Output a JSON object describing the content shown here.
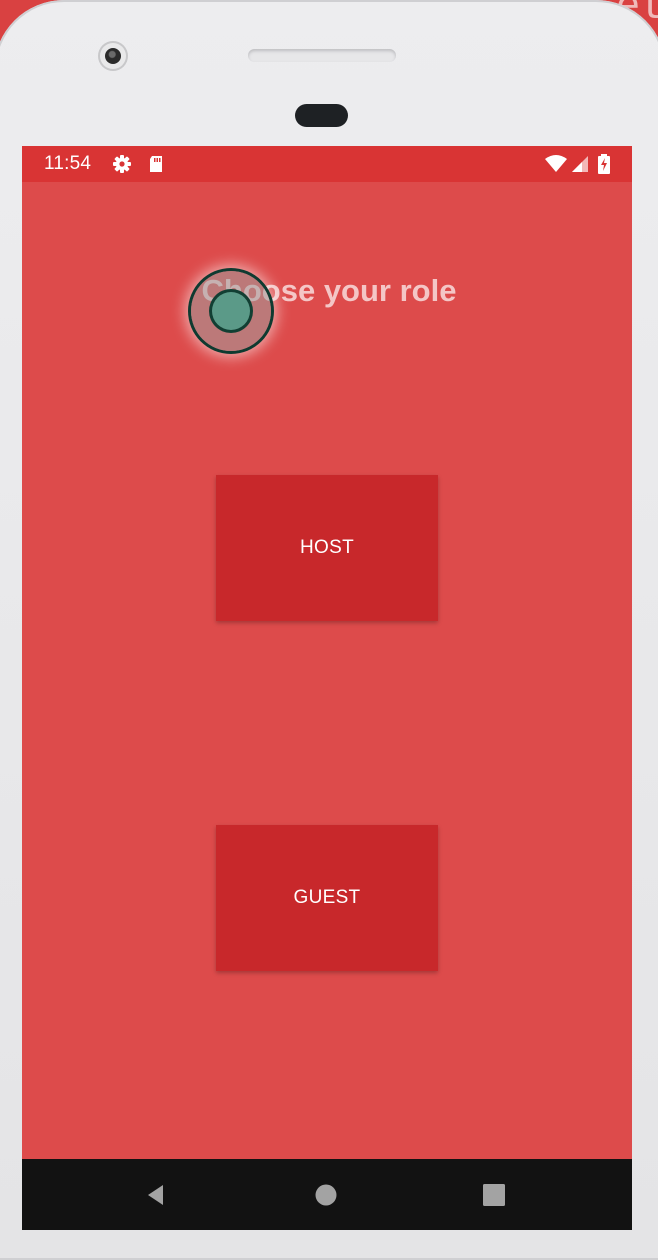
{
  "status_bar": {
    "time": "11:54",
    "icons": [
      "gear-icon",
      "sd-card-icon",
      "wifi-icon",
      "cell-signal-icon",
      "battery-charging-icon"
    ]
  },
  "main": {
    "title": "Choose your role",
    "host_label": "HOST",
    "guest_label": "GUEST"
  },
  "backdrop": {
    "partial_text": "et"
  },
  "nav_bar": {
    "icons": [
      "back-icon",
      "home-icon",
      "recents-icon"
    ]
  },
  "colors": {
    "status_bar": "#d93434",
    "screen_background": "#dd4b4b",
    "button_background": "#c8282b",
    "title_text": "#f4c6c6",
    "nav_bar": "#121212"
  }
}
